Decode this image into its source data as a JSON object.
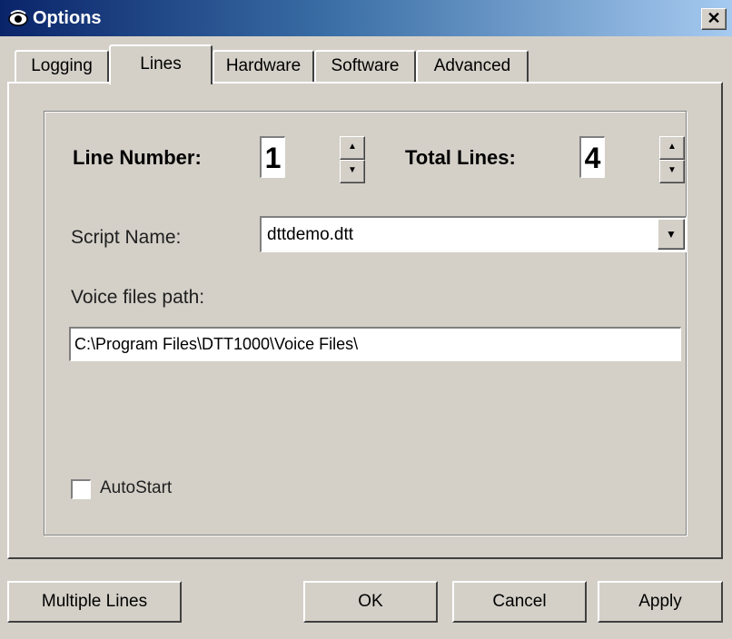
{
  "window": {
    "title": "Options",
    "close_glyph": "✕",
    "icon": "app-eye-icon"
  },
  "tabs": [
    {
      "label": "Logging",
      "active": false
    },
    {
      "label": "Lines",
      "active": true
    },
    {
      "label": "Hardware",
      "active": false
    },
    {
      "label": "Software",
      "active": false
    },
    {
      "label": "Advanced",
      "active": false
    }
  ],
  "lines": {
    "line_number_label": "Line Number:",
    "line_number_value": "1",
    "total_lines_label": "Total Lines:",
    "total_lines_value": "4",
    "script_name_label": "Script Name:",
    "script_name_value": "dttdemo.dtt",
    "voice_path_label": "Voice files path:",
    "voice_path_value": "C:\\Program Files\\DTT1000\\Voice Files\\",
    "autostart_label": "AutoStart",
    "autostart_checked": false
  },
  "buttons": {
    "multiple_lines": "Multiple Lines",
    "ok": "OK",
    "cancel": "Cancel",
    "apply": "Apply"
  },
  "icons": {
    "spin_up": "▲",
    "spin_down": "▼",
    "dropdown": "▼"
  },
  "colors": {
    "title_gradient_start": "#0a246a",
    "title_gradient_end": "#a6caf0",
    "face": "#d4d0c8"
  }
}
